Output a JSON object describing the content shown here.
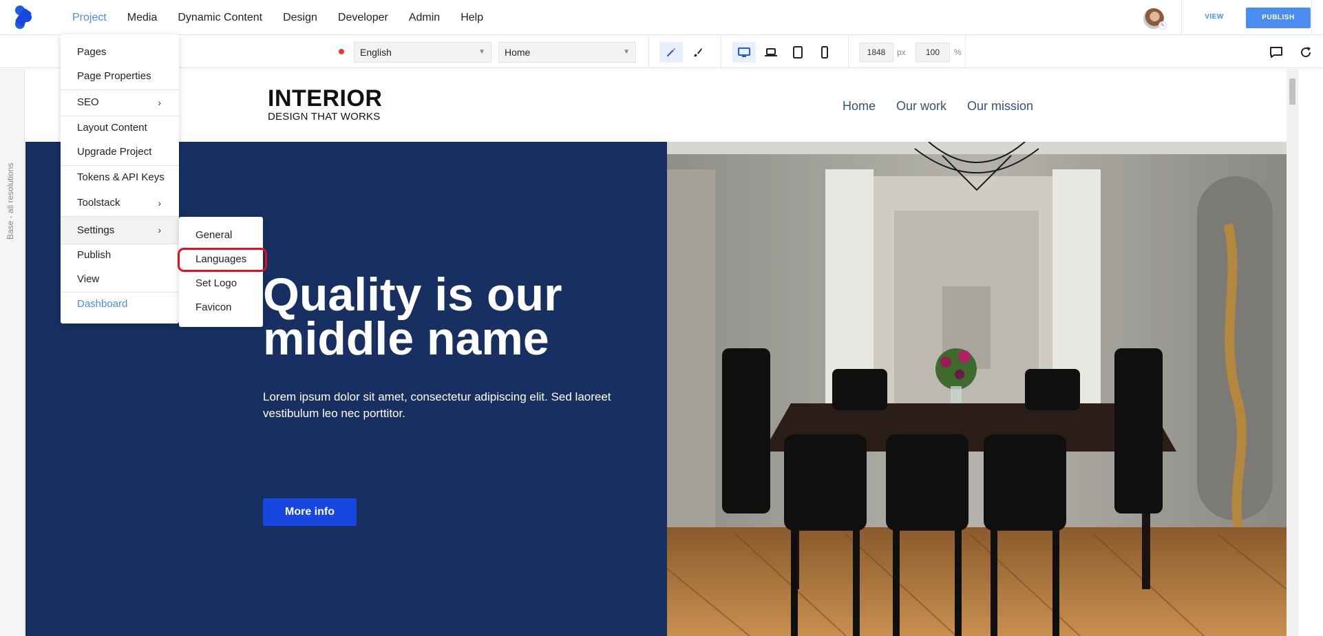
{
  "topbar": {
    "menu": [
      "Project",
      "Media",
      "Dynamic Content",
      "Design",
      "Developer",
      "Admin",
      "Help"
    ],
    "active_menu": "Project",
    "view_label": "VIEW",
    "publish_label": "PUBLISH",
    "accent_color": "#4a8cf0"
  },
  "toolbar": {
    "language": "English",
    "page": "Home",
    "width_value": "1848",
    "width_unit": "px",
    "zoom_value": "100",
    "zoom_unit": "%",
    "tools": [
      "pencil-icon",
      "brush-icon"
    ],
    "devices": [
      "desktop-icon",
      "laptop-icon",
      "tablet-icon",
      "phone-icon"
    ],
    "right_tools": [
      "comment-icon",
      "refresh-icon"
    ]
  },
  "left_strip": {
    "label": "Base - all resolutions"
  },
  "project_menu": {
    "items": [
      {
        "label": "Pages"
      },
      {
        "label": "Page Properties"
      },
      {
        "label": "SEO"
      },
      {
        "label": "Layout Content"
      },
      {
        "label": "Upgrade Project"
      },
      {
        "label": "Tokens & API Keys"
      },
      {
        "label": "Toolstack"
      },
      {
        "label": "Settings"
      },
      {
        "label": "Publish"
      },
      {
        "label": "View"
      },
      {
        "label": "Dashboard"
      }
    ],
    "submenu_arrow": "›"
  },
  "settings_submenu": {
    "items": [
      {
        "label": "General"
      },
      {
        "label": "Languages"
      },
      {
        "label": "Set Logo"
      },
      {
        "label": "Favicon"
      }
    ],
    "highlighted": "Languages"
  },
  "site": {
    "brand_title": "INTERIOR",
    "brand_subtitle": "DESIGN THAT WORKS",
    "nav": [
      "Home",
      "Our work",
      "Our mission"
    ],
    "hero_title": "Quality is our middle name",
    "hero_text": "Lorem ipsum dolor sit amet, consectetur adipiscing elit. Sed laoreet vestibulum leo nec porttitor.",
    "hero_button": "More info",
    "hero_bg": "#172f61",
    "button_color": "#1746e0"
  }
}
